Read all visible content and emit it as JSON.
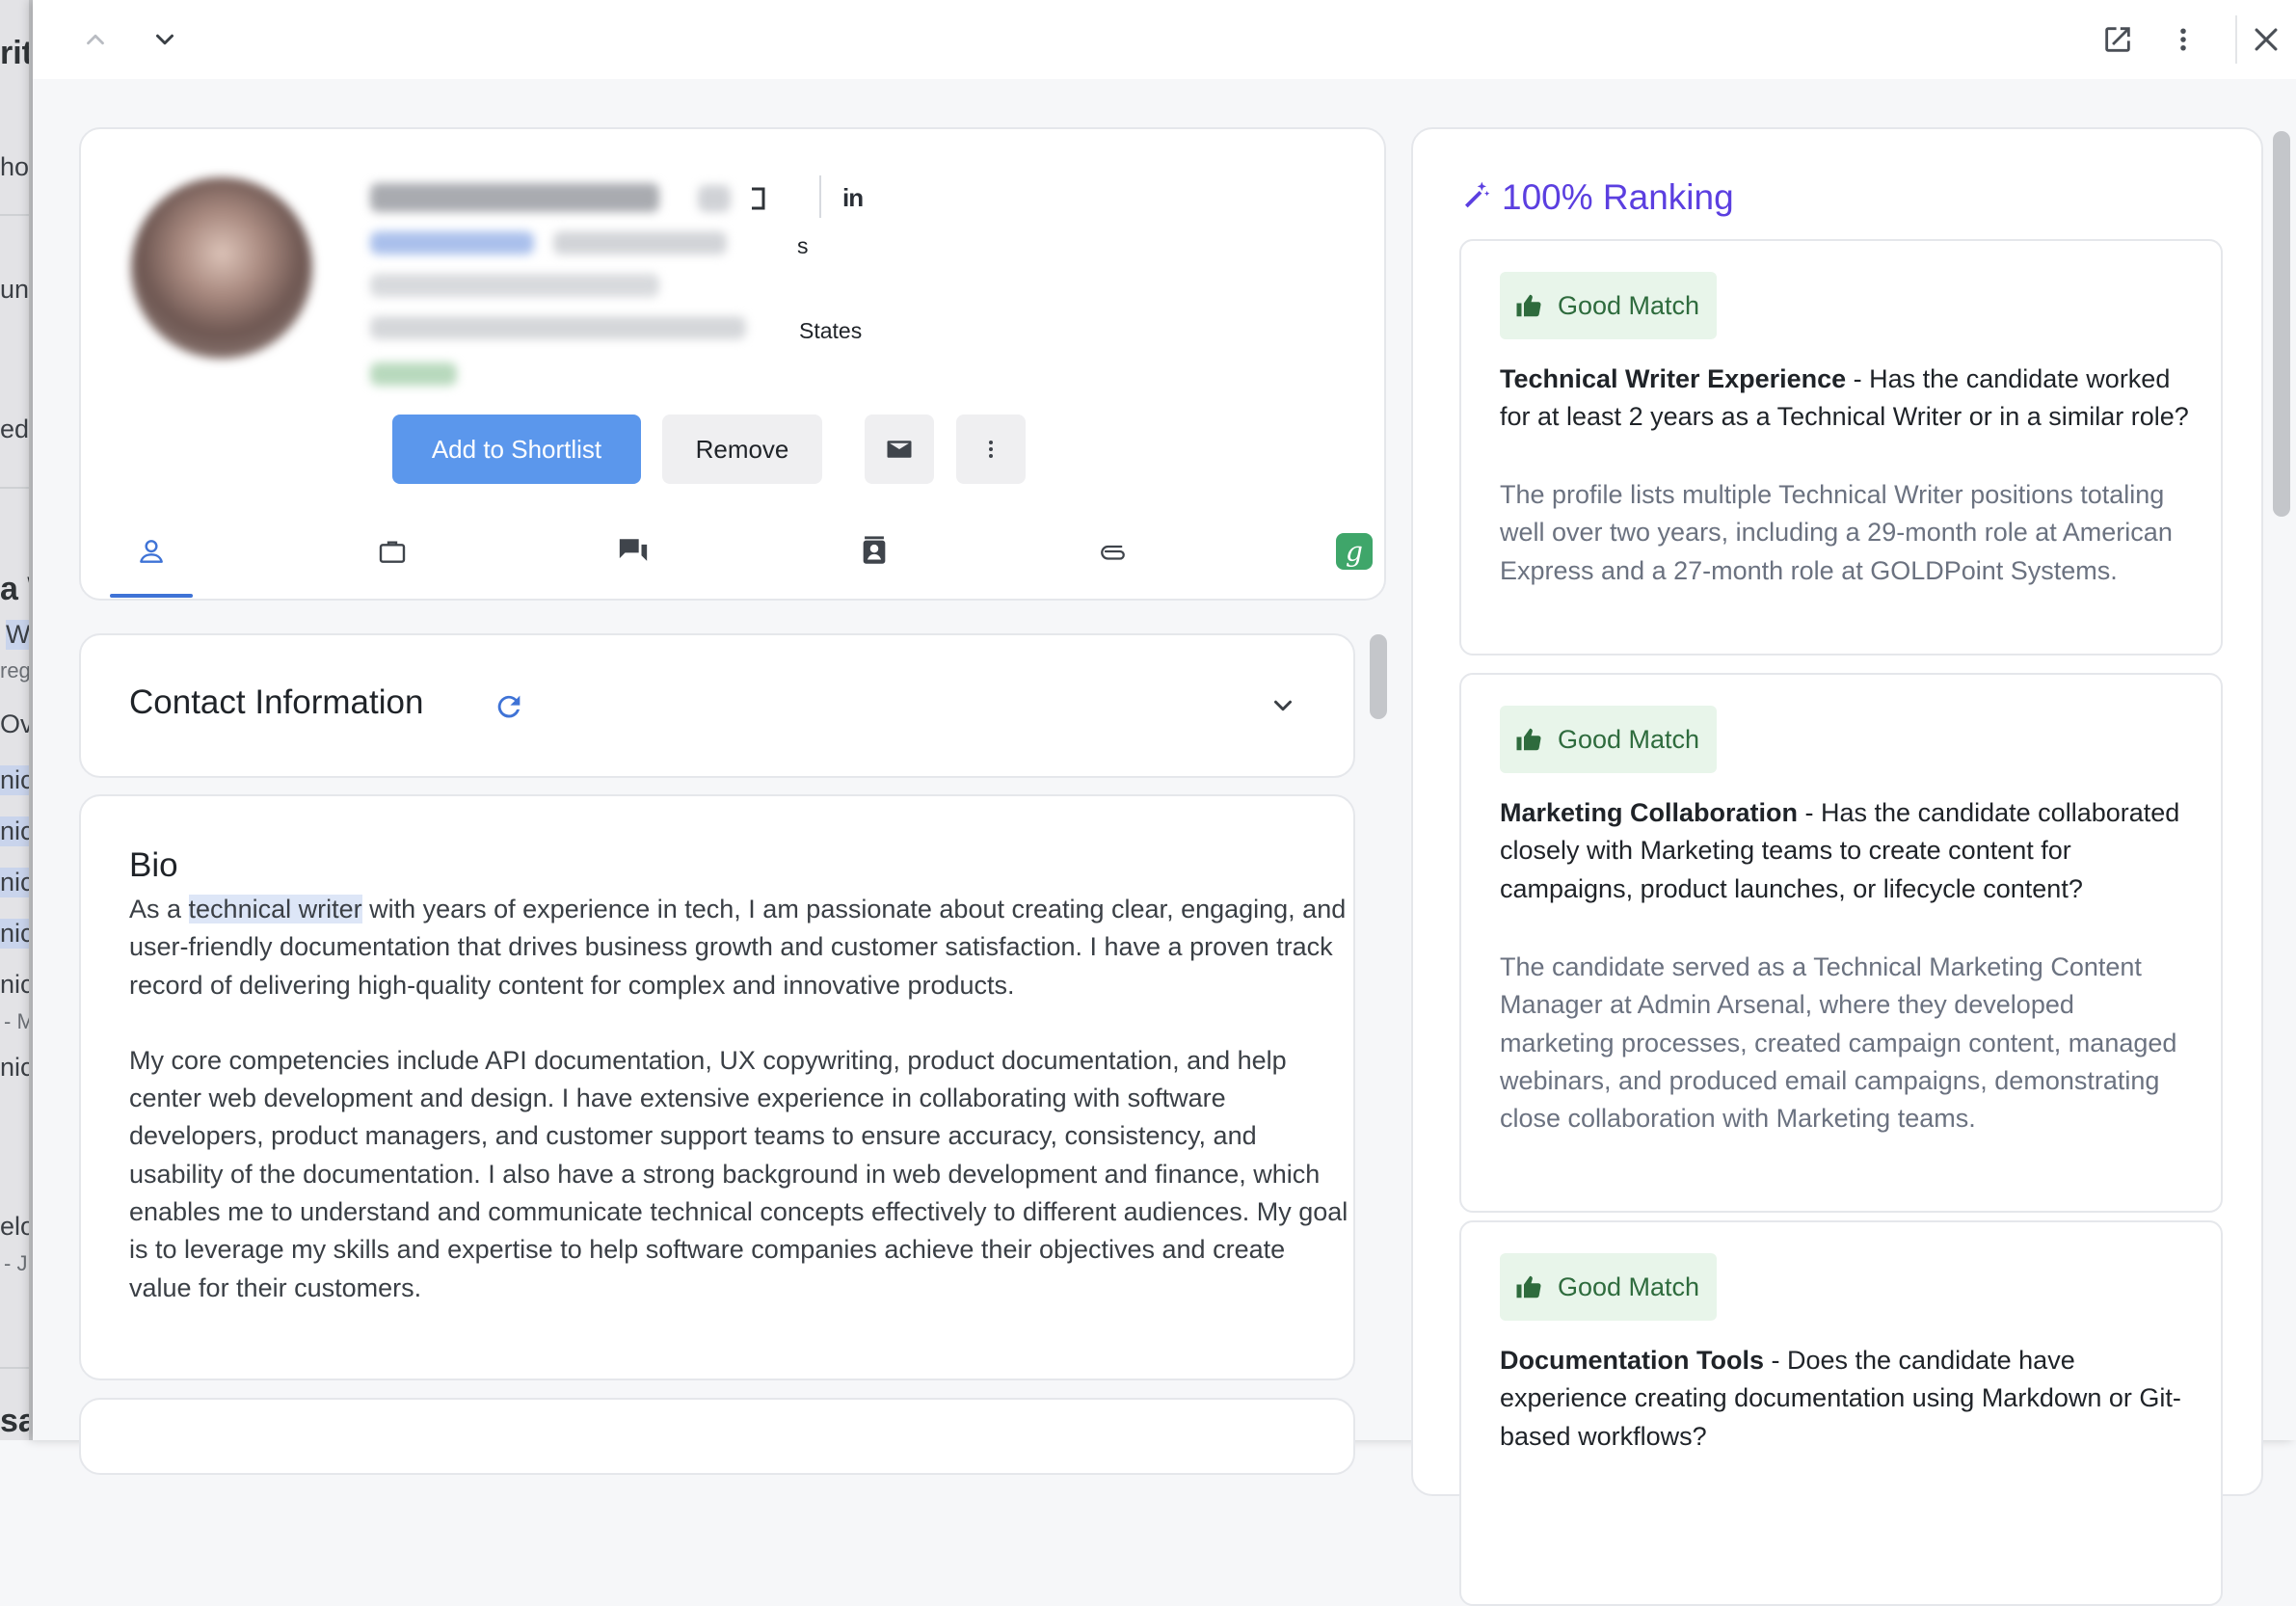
{
  "underlay": {
    "fragments": [
      "rite",
      "ho",
      "un",
      "ed",
      "a W",
      "W",
      "reg",
      "Ove",
      "nic",
      "nic",
      "nic",
      "nic",
      "nic",
      "- M",
      "nic",
      "elo",
      "- J",
      "sa"
    ]
  },
  "profile": {
    "trail_line1": "s",
    "trail_line3": "States",
    "linkedin": "in",
    "add_shortlist": "Add to Shortlist",
    "remove": "Remove",
    "g_badge": "g"
  },
  "contact": {
    "title": "Contact Information"
  },
  "bio": {
    "title": "Bio",
    "p1_prefix": "As a ",
    "p1_highlight": "technical writer",
    "p1_rest": " with years of experience in tech, I am passionate about creating clear, engaging, and user-friendly documentation that drives business growth and customer satisfaction. I have a proven track record of delivering high-quality content for complex and innovative products.",
    "p2": "My core competencies include API documentation, UX copywriting, product documentation, and help center web development and design. I have extensive experience in collaborating with software developers, product managers, and customer support teams to ensure accuracy, consistency, and usability of the documentation. I also have a strong background in web development and finance, which enables me to understand and communicate technical concepts effectively to different audiences. My goal is to leverage my skills and expertise to help software companies achieve their objectives and create value for their customers."
  },
  "ranking": {
    "title": "100% Ranking",
    "accent": "#5b3fe0",
    "matches": [
      {
        "badge": "Good Match",
        "criterion": "Technical Writer Experience",
        "question": " - Has the candidate worked for at least 2 years as a Technical Writer or in a similar role?",
        "reason": "The profile lists multiple Technical Writer positions totaling well over two years, including a 29-month role at American Express and a 27-month role at GOLDPoint Systems."
      },
      {
        "badge": "Good Match",
        "criterion": "Marketing Collaboration",
        "question": " - Has the candidate collaborated closely with Marketing teams to create content for campaigns, product launches, or lifecycle content?",
        "reason": "The candidate served as a Technical Marketing Content Manager at Admin Arsenal, where they developed marketing processes, created campaign content, managed webinars, and produced email campaigns, demonstrating close collaboration with Marketing teams."
      },
      {
        "badge": "Good Match",
        "criterion": "Documentation Tools",
        "question": " - Does the candidate have experience creating documentation using Markdown or Git-based workflows?",
        "reason": ""
      }
    ]
  }
}
